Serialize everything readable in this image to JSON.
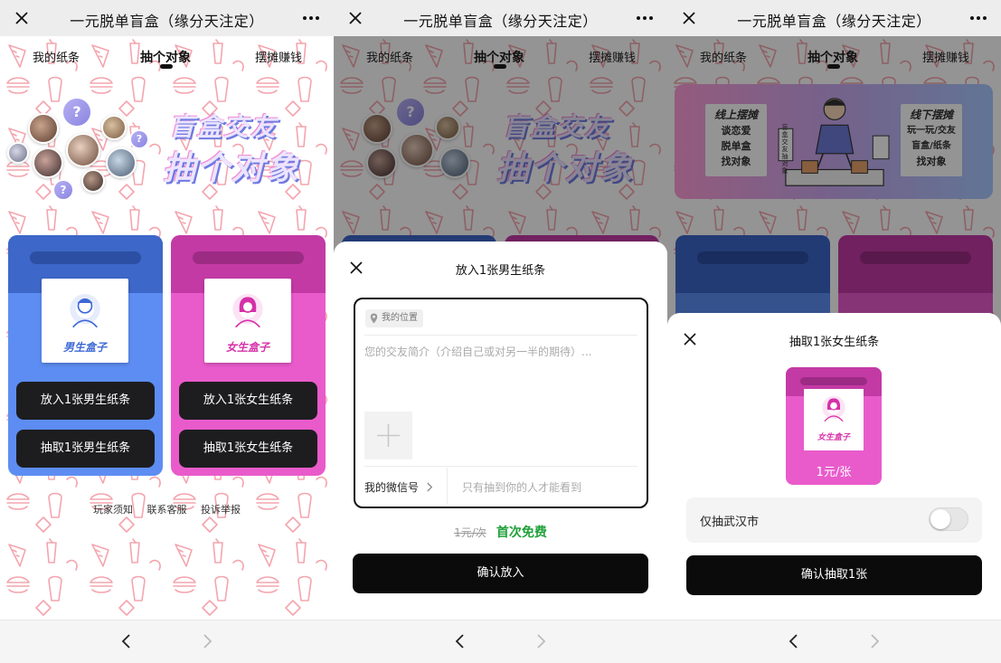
{
  "window": {
    "title": "一元脱单盲盒（缘分天注定）"
  },
  "tabs": [
    "我的纸条",
    "抽个对象",
    "摆摊赚钱"
  ],
  "home": {
    "banner_line1": "盲盒交友",
    "banner_line2": "抽个对象",
    "male_box_label": "男生盒子",
    "female_box_label": "女生盒子",
    "male_put_button": "放入1张男生纸条",
    "male_draw_button": "抽取1张男生纸条",
    "female_put_button": "放入1张女生纸条",
    "female_draw_button": "抽取1张女生纸条",
    "footer_links": [
      "玩家须知",
      "联系客服",
      "投诉举报"
    ]
  },
  "put_sheet": {
    "title": "放入1张男生纸条",
    "location_chip": "我的位置",
    "intro_placeholder": "您的交友简介（介绍自己或对另一半的期待）...",
    "wechat_label": "我的微信号",
    "wechat_placeholder": "只有抽到你的人才能看到",
    "price_old": "1元/次",
    "price_free": "首次免费",
    "confirm_button": "确认放入"
  },
  "stall_banner": {
    "online_title": "线上摆摊",
    "online_lines": [
      "谈恋爱",
      "脱单盒",
      "找对象"
    ],
    "offline_title": "线下摆摊",
    "offline_lines": [
      "玩一玩/交友",
      "盲盒/纸条",
      "找对象"
    ],
    "stall_sign": [
      "盲盒",
      "交友",
      "抽对象"
    ]
  },
  "draw_sheet": {
    "title": "抽取1张女生纸条",
    "box_label": "女生盒子",
    "price": "1元/张",
    "filter_label": "仅抽武汉市",
    "filter_on": false,
    "confirm_button": "确认抽取1张"
  },
  "colors": {
    "male_card": "#5d8df3",
    "female_card": "#e95bcb",
    "dark_button": "#1d1d1f",
    "free_green": "#1fa038",
    "pattern": "#f4a5ae"
  }
}
